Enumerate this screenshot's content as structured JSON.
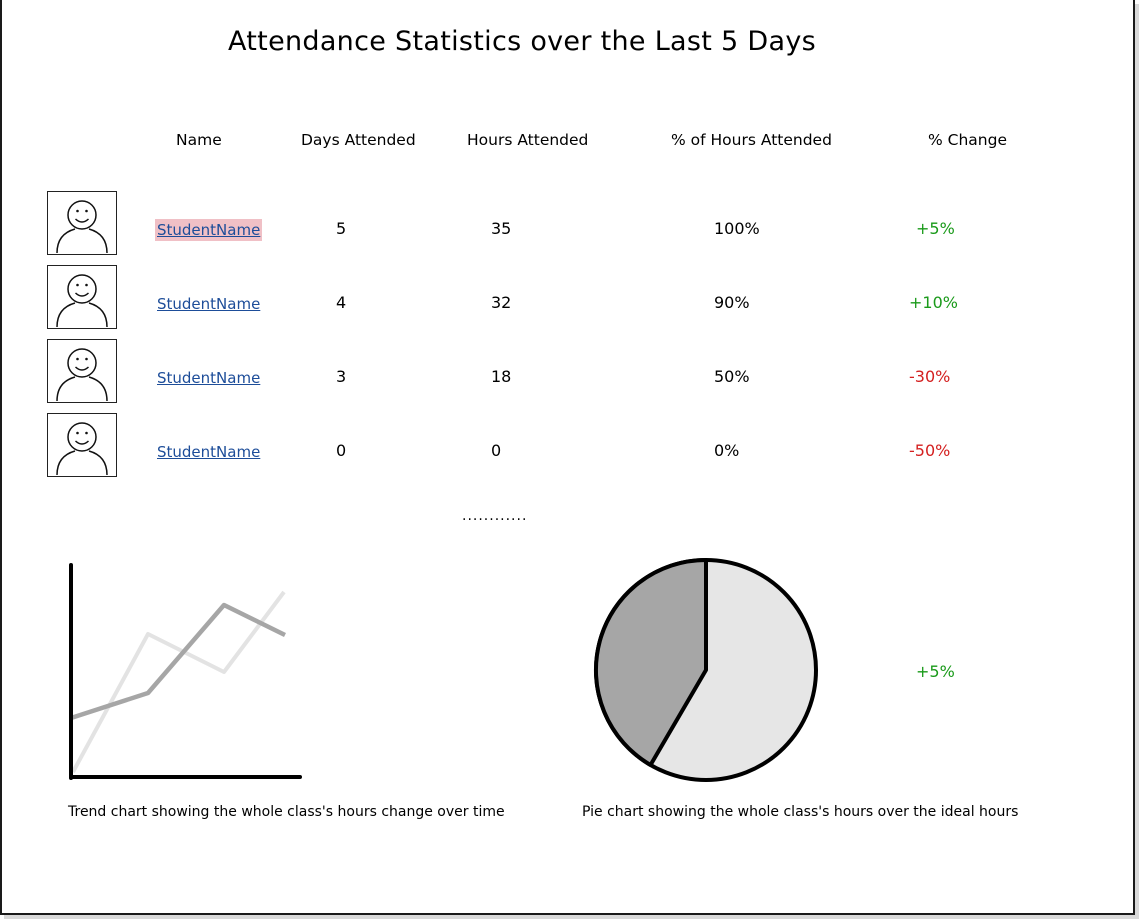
{
  "page": {
    "title": "Attendance Statistics over the Last 5 Days"
  },
  "table": {
    "headers": {
      "name": "Name",
      "days": "Days Attended",
      "hours": "Hours Attended",
      "percent": "% of Hours Attended",
      "change": "% Change"
    },
    "rows": [
      {
        "name": "StudentName",
        "days": "5",
        "hours": "35",
        "percent": "100%",
        "change": "+5%",
        "trend": "positive",
        "selected": true
      },
      {
        "name": "StudentName",
        "days": "4",
        "hours": "32",
        "percent": "90%",
        "change": "+10%",
        "trend": "positive",
        "selected": false
      },
      {
        "name": "StudentName",
        "days": "3",
        "hours": "18",
        "percent": "50%",
        "change": "-30%",
        "trend": "negative",
        "selected": false
      },
      {
        "name": "StudentName",
        "days": "0",
        "hours": "0",
        "percent": "0%",
        "change": "-50%",
        "trend": "negative",
        "selected": false
      }
    ],
    "more_indicator": "............"
  },
  "trend_chart": {
    "caption": "Trend chart showing the whole class's hours change over time",
    "icon": "line-chart-placeholder"
  },
  "pie_chart": {
    "caption": "Pie chart showing the whole class's hours over the ideal hours",
    "change": "+5%",
    "icon": "pie-chart-placeholder"
  },
  "colors": {
    "link": "#1d4d99",
    "selected_highlight": "#f0c0c6",
    "positive": "#1a9a1a",
    "negative": "#d42020",
    "pie_dark": "#a6a6a6",
    "pie_light": "#e6e6e6",
    "line_dark": "#a6a6a6",
    "line_light": "#e3e3e3"
  }
}
